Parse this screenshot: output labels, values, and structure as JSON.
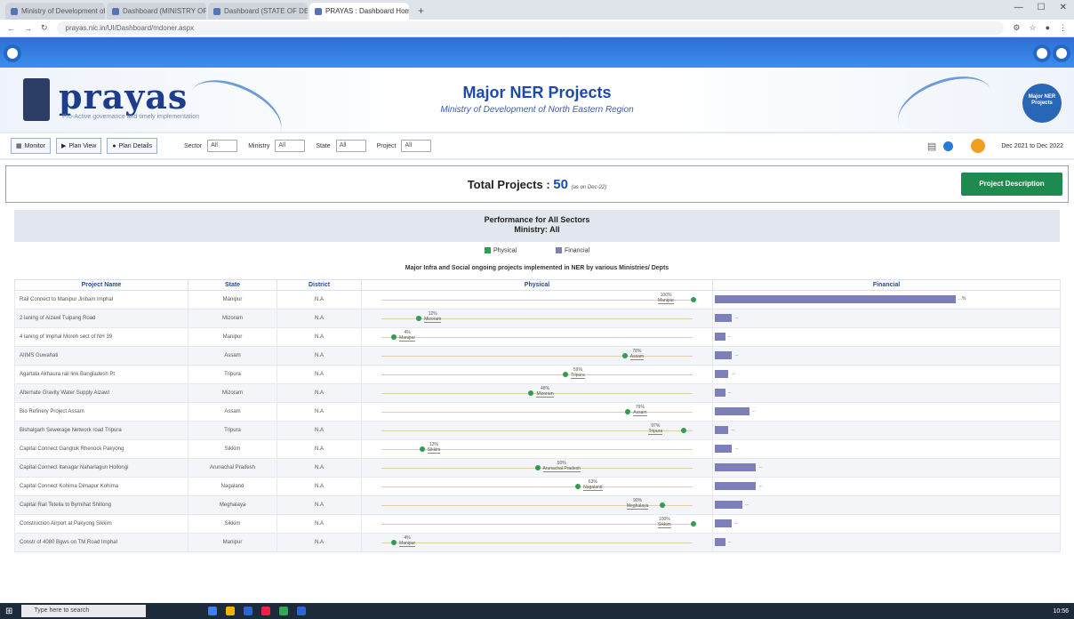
{
  "browser": {
    "tabs": [
      {
        "title": "Ministry of Development of North...",
        "active": false
      },
      {
        "title": "Dashboard (MINISTRY OF DEVE...",
        "active": false
      },
      {
        "title": "Dashboard (STATE OF DEV...",
        "active": false
      },
      {
        "title": "PRAYAS : Dashboard Home",
        "active": true
      }
    ],
    "new_tab": "+",
    "url": "prayas.nic.in/UI/Dashboard/mdoner.aspx"
  },
  "header": {
    "logo": "prayas",
    "tagline": "Pro-Active governance and timely implementation",
    "title": "Major NER Projects",
    "subtitle": "Ministry of Development of North Eastern Region",
    "badge": "Major NER Projects"
  },
  "filters": {
    "buttons": [
      "Monitor",
      "Plan View",
      "Plan Details"
    ],
    "sector_label": "Sector",
    "sector_value": "All",
    "ministry_label": "Ministry",
    "ministry_value": "All",
    "state_label": "State",
    "state_value": "All",
    "project_label": "Project",
    "project_value": "All",
    "date_range": "Dec 2021 to Dec 2022"
  },
  "summary": {
    "label": "Total Projects :",
    "count": "50",
    "note": "(as on Dec-22)",
    "button": "Project Description"
  },
  "performance": {
    "title": "Performance for All Sectors",
    "ministry": "Ministry: All"
  },
  "legend": {
    "physical": "Physical",
    "financial": "Financial"
  },
  "table_title": "Major Infra and Social ongoing projects implemented in NER by various Ministries/ Depts",
  "columns": {
    "name": "Project Name",
    "state": "State",
    "district": "District",
    "physical": "Physical",
    "financial": "Financial"
  },
  "colors": {
    "physical_dot": "#2e9d4e",
    "financial_bar": "#7d7fb8",
    "accent": "#1e4aa8"
  },
  "chart_data": {
    "type": "table",
    "rows": [
      {
        "name": "Rail Connect to Manipur Jiribam Imphal",
        "state": "Manipur",
        "district": "N.A",
        "physical": 100,
        "physical_label": "100%",
        "financial": 70,
        "financial_label": "...%"
      },
      {
        "name": "2 laning of Aizawl Tuipang Road",
        "state": "Mizoram",
        "district": "N.A",
        "physical": 12,
        "physical_label": "12%",
        "financial": 5,
        "financial_label": "..."
      },
      {
        "name": "4 laning of Imphal Moreh sect of NH 39",
        "state": "Manipur",
        "district": "N.A",
        "physical": 4,
        "physical_label": "4%",
        "financial": 3,
        "financial_label": "..."
      },
      {
        "name": "AIIMS Guwahati",
        "state": "Assam",
        "district": "N.A",
        "physical": 78,
        "physical_label": "78%",
        "financial": 5,
        "financial_label": "..."
      },
      {
        "name": "Agartala Akhaura rail link Bangladesh Pt",
        "state": "Tripura",
        "district": "N.A",
        "physical": 59,
        "physical_label": "59%",
        "financial": 4,
        "financial_label": "..."
      },
      {
        "name": "Alternate Gravity Water Supply Aizawl",
        "state": "Mizoram",
        "district": "N.A",
        "physical": 48,
        "physical_label": "48%",
        "financial": 3,
        "financial_label": "..."
      },
      {
        "name": "Bio Refinery Project Assam",
        "state": "Assam",
        "district": "N.A",
        "physical": 79,
        "physical_label": "79%",
        "financial": 10,
        "financial_label": "..."
      },
      {
        "name": "Bishalgarh Sewerage Network road Tripura",
        "state": "Tripura",
        "district": "N.A",
        "physical": 97,
        "physical_label": "97%",
        "financial": 4,
        "financial_label": "..."
      },
      {
        "name": "Capital Connect Gangtok Rhenock Pakyong",
        "state": "Sikkim",
        "district": "N.A",
        "physical": 13,
        "physical_label": "13%",
        "financial": 5,
        "financial_label": "..."
      },
      {
        "name": "Capital Connect Itanagar Naharlagun Hollongi",
        "state": "Arunachal Pradesh",
        "district": "N.A",
        "physical": 50,
        "physical_label": "50%",
        "financial": 12,
        "financial_label": "..."
      },
      {
        "name": "Capital Connect Kohima Dimapur Kohima",
        "state": "Nagaland",
        "district": "N.A",
        "physical": 63,
        "physical_label": "63%",
        "financial": 12,
        "financial_label": "..."
      },
      {
        "name": "Capital Rail Tetelia to Byrnihat Shillong",
        "state": "Meghalaya",
        "district": "N.A",
        "physical": 90,
        "physical_label": "90%",
        "financial": 8,
        "financial_label": "..."
      },
      {
        "name": "Construction Airport at Pakyong Sikkim",
        "state": "Sikkim",
        "district": "N.A",
        "physical": 100,
        "physical_label": "100%",
        "financial": 5,
        "financial_label": "..."
      },
      {
        "name": "Constr of 4080 Bgws on TM Road Imphal",
        "state": "Manipur",
        "district": "N.A",
        "physical": 4,
        "physical_label": "4%",
        "financial": 3,
        "financial_label": "..."
      }
    ]
  },
  "taskbar": {
    "search": "Type here to search",
    "time": "10:56"
  }
}
